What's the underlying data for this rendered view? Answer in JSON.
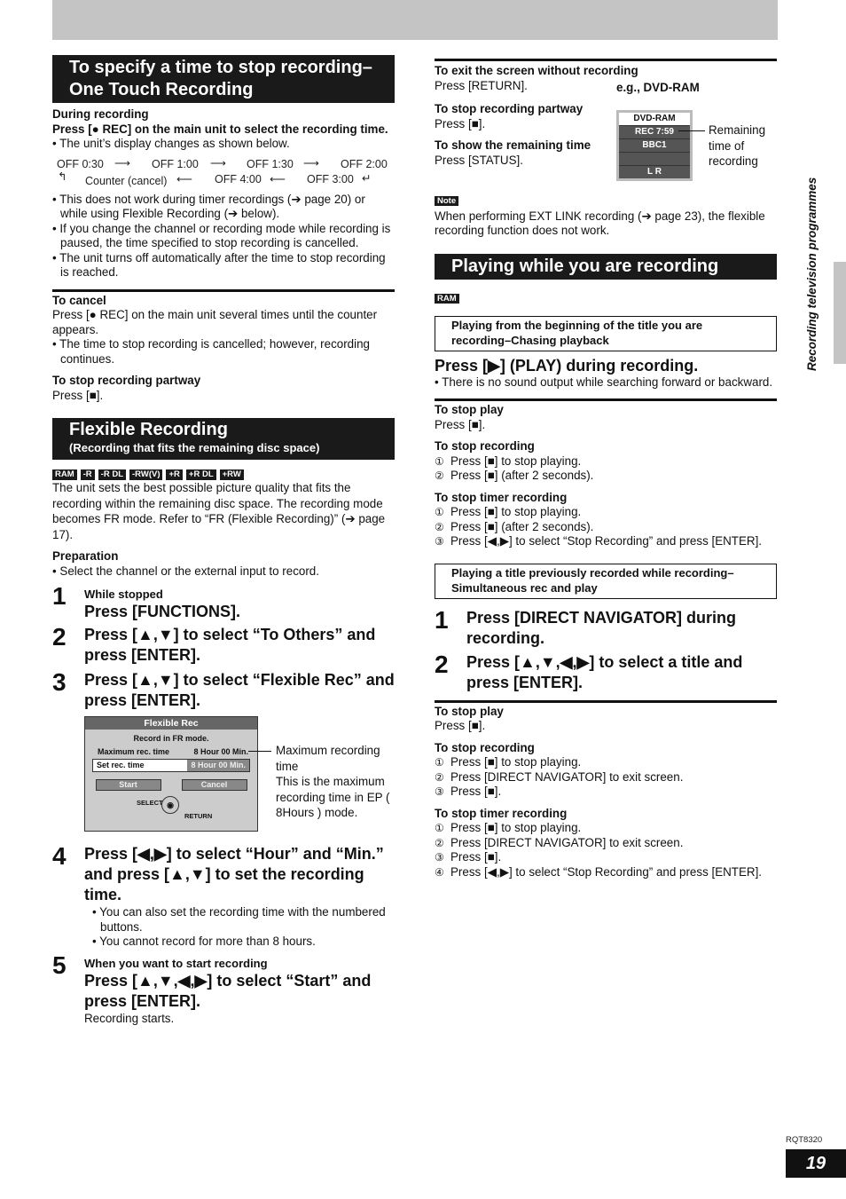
{
  "side_label": "Recording television programmes",
  "footer": {
    "code": "RQT8320",
    "page_number": "19"
  },
  "one_touch": {
    "title": "To specify a time to stop recording–One Touch Recording",
    "during": "During recording",
    "instruction": "Press [● REC] on the main unit to select the recording time.",
    "display_note": "The unit’s display changes as shown below.",
    "cycle": [
      "OFF 0:30",
      "OFF 1:00",
      "OFF 1:30",
      "OFF 2:00",
      "OFF 3:00",
      "OFF 4:00",
      "Counter (cancel)"
    ],
    "bullets": [
      "This does not work during timer recordings (➔ page 20) or while using Flexible Recording (➔ below).",
      "If you change the channel or recording mode while recording is paused, the time specified to stop recording is cancelled.",
      "The unit turns off automatically after the time to stop recording is reached."
    ],
    "cancel_title": "To cancel",
    "cancel_text": "Press [● REC] on the main unit several times until the counter appears.",
    "cancel_bullet": "The time to stop recording is cancelled; however, recording continues.",
    "stop_title": "To stop recording partway",
    "stop_text": "Press [■]."
  },
  "flexible": {
    "title": "Flexible Recording",
    "subtitle": "(Recording that fits the remaining disc space)",
    "tags": [
      "RAM",
      "-R",
      "-R DL",
      "-RW(V)",
      "+R",
      "+R DL",
      "+RW"
    ],
    "intro": "The unit sets the best possible picture quality that fits the recording within the remaining disc space. The recording mode becomes FR mode. Refer to “FR (Flexible Recording)” (➔ page 17).",
    "prep_title": "Preparation",
    "prep_bullet": "Select the channel or the external input to record.",
    "steps": [
      {
        "num": "1",
        "pre": "While stopped",
        "main": "Press [FUNCTIONS]."
      },
      {
        "num": "2",
        "main": "Press [▲,▼] to select “To Others” and press [ENTER]."
      },
      {
        "num": "3",
        "main": "Press [▲,▼] to select “Flexible Rec” and press [ENTER]."
      },
      {
        "num": "4",
        "main": "Press [◀,▶] to select “Hour” and “Min.” and press [▲,▼] to set the recording time.",
        "bullets": [
          "You can also set the recording time with the numbered buttons.",
          "You cannot record for more than 8 hours."
        ]
      },
      {
        "num": "5",
        "pre": "When you want to start recording",
        "main": "Press [▲,▼,◀,▶] to select “Start” and press [ENTER].",
        "after": "Recording starts."
      }
    ],
    "osd": {
      "header": "Flexible Rec",
      "mode_line": "Record in FR mode.",
      "max_label": "Maximum rec. time",
      "max_value": "8 Hour 00 Min.",
      "set_label": "Set rec. time",
      "set_value": "8 Hour 00 Min.",
      "start": "Start",
      "cancel": "Cancel",
      "select": "SELECT",
      "return": "RETURN",
      "note": "Maximum recording time\nThis is the maximum recording time in EP ( 8Hours ) mode."
    },
    "exit_title": "To exit the screen without recording",
    "exit_text": "Press [RETURN].",
    "example": "e.g., DVD-RAM",
    "stop_title": "To stop recording partway",
    "stop_text": "Press [■].",
    "remain_title": "To show the remaining time",
    "remain_text": "Press [STATUS].",
    "display_rows": [
      "DVD-RAM",
      "REC 7:59",
      "BBC1",
      "",
      "L R"
    ],
    "display_note": "Remaining time of recording",
    "note_label": "Note",
    "note_text": "When performing EXT LINK recording (➔ page 23), the flexible recording function does not work."
  },
  "playing": {
    "title": "Playing while you are recording",
    "tag": "RAM",
    "chase": {
      "heading": "Playing from the beginning of the title you are recording–Chasing playback",
      "main": "Press [▶] (PLAY) during recording.",
      "bullet": "There is no sound output while searching forward or backward.",
      "stop_play_title": "To stop play",
      "stop_play_text": "Press [■].",
      "stop_rec_title": "To stop recording",
      "stop_rec": [
        "Press [■] to stop playing.",
        "Press [■] (after 2 seconds)."
      ],
      "stop_timer_title": "To stop timer recording",
      "stop_timer": [
        "Press [■] to stop playing.",
        "Press [■] (after 2 seconds).",
        "Press [◀,▶] to select “Stop Recording” and press [ENTER]."
      ]
    },
    "simul": {
      "heading": "Playing a title previously recorded while recording–Simultaneous rec and play",
      "steps": [
        {
          "num": "1",
          "main": "Press [DIRECT NAVIGATOR] during recording."
        },
        {
          "num": "2",
          "main": "Press [▲,▼,◀,▶] to select a title and press [ENTER]."
        }
      ],
      "stop_play_title": "To stop play",
      "stop_play_text": "Press [■].",
      "stop_rec_title": "To stop recording",
      "stop_rec": [
        "Press [■] to stop playing.",
        "Press [DIRECT NAVIGATOR] to exit screen.",
        "Press [■]."
      ],
      "stop_timer_title": "To stop timer recording",
      "stop_timer": [
        "Press [■] to stop playing.",
        "Press [DIRECT NAVIGATOR] to exit screen.",
        "Press [■].",
        "Press [◀,▶] to select “Stop Recording” and press [ENTER]."
      ]
    },
    "circled": [
      "①",
      "②",
      "③",
      "④"
    ]
  }
}
